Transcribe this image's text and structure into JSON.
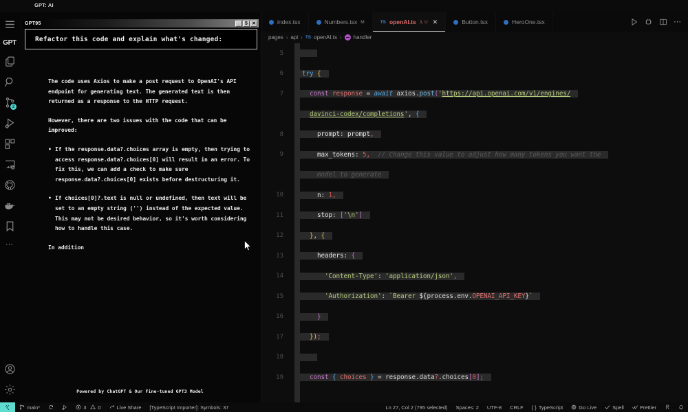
{
  "window": {
    "title": "GPT: AI"
  },
  "activity_bar": {
    "brand": "GPT",
    "items": [
      {
        "name": "menu-icon",
        "label": "Menu"
      },
      {
        "name": "explorer-icon",
        "label": "Explorer"
      },
      {
        "name": "search-icon",
        "label": "Search"
      },
      {
        "name": "source-control-icon",
        "label": "Source Control",
        "badge": "2"
      },
      {
        "name": "run-debug-icon",
        "label": "Run and Debug"
      },
      {
        "name": "extensions-icon",
        "label": "Extensions"
      },
      {
        "name": "remote-explorer-icon",
        "label": "Remote Explorer"
      },
      {
        "name": "github-icon",
        "label": "GitHub"
      },
      {
        "name": "docker-icon",
        "label": "Docker"
      },
      {
        "name": "bookmarks-icon",
        "label": "Bookmarks"
      },
      {
        "name": "more-views-icon",
        "label": "Additional Views"
      },
      {
        "name": "account-icon",
        "label": "Accounts"
      },
      {
        "name": "settings-gear-icon",
        "label": "Manage"
      }
    ]
  },
  "chat_panel": {
    "retro_window": {
      "title": "GPT95",
      "buttons": [
        {
          "name": "minimize-button",
          "glyph": "_"
        },
        {
          "name": "maximize-button",
          "glyph": "5"
        },
        {
          "name": "close-button",
          "glyph": "✕"
        }
      ]
    },
    "prompt": "Refactor this code and explain what's changed:",
    "paragraphs": [
      "The code uses Axios to make a post request to OpenAI's API endpoint for generating text. The generated text is then returned as a response to the HTTP request.",
      "However, there are two issues with the code that can be improved:"
    ],
    "bullets": [
      "If the response.data?.choices array is empty, then trying to access response.data?.choices[0] will result in an error. To fix this, we can add a check to make sure response.data?.choices[0] exists before destructuring it.",
      "If choices[0]?.text is null or undefined, then text will be set to an empty string ('') instead of the expected value. This may not be desired behavior, so it's worth considering how to handle this case."
    ],
    "tail": "In addition",
    "footer": "Powered by ChatGPT & Our Fine-tuned GPT3 Model"
  },
  "tabs": [
    {
      "name": "index.tsx",
      "suffix": "",
      "badge": "dot",
      "active": false
    },
    {
      "name": "Numbers.tsx",
      "suffix": "M",
      "badge": "dot",
      "active": false
    },
    {
      "name": "openAI.ts",
      "suffix": "3, U",
      "badge": "TS",
      "active": true,
      "close": "✕"
    },
    {
      "name": "Button.tsx",
      "suffix": "",
      "badge": "dot",
      "active": false
    },
    {
      "name": "HeroOne.tsx",
      "suffix": "",
      "badge": "dot",
      "active": false
    }
  ],
  "tab_actions": [
    {
      "name": "run-file-icon",
      "label": "Run Code"
    },
    {
      "name": "run-debug-split-icon",
      "label": "Run and Debug"
    },
    {
      "name": "split-editor-icon",
      "label": "Split Editor"
    },
    {
      "name": "more-actions-icon",
      "label": "More Actions..."
    }
  ],
  "breadcrumb": [
    "pages",
    "api",
    "openAI.ts",
    "handler"
  ],
  "code": {
    "lines": [
      {
        "n": "5",
        "segments": []
      },
      {
        "n": "6",
        "segments": [
          {
            "t": "  ",
            "c": "pun"
          },
          {
            "t": "try",
            "c": "kw2"
          },
          {
            "t": " ",
            "c": "pun"
          },
          {
            "t": "{",
            "c": "br1"
          }
        ]
      },
      {
        "n": "7",
        "segments": [
          {
            "t": "    ",
            "c": "pun"
          },
          {
            "t": "const",
            "c": "k"
          },
          {
            "t": " ",
            "c": "pun"
          },
          {
            "t": "response",
            "c": "var"
          },
          {
            "t": " = ",
            "c": "pun"
          },
          {
            "t": "await",
            "c": "aw"
          },
          {
            "t": " axios",
            "c": "id"
          },
          {
            "t": ".",
            "c": "pun"
          },
          {
            "t": "post",
            "c": "fn"
          },
          {
            "t": "(",
            "c": "br2"
          },
          {
            "t": "'",
            "c": "str"
          },
          {
            "t": "https://api.openai.com/v1/engines/",
            "c": "strU"
          }
        ]
      },
      {
        "n": "",
        "segments": [
          {
            "t": "    ",
            "c": "pun"
          },
          {
            "t": "davinci-codex/completions",
            "c": "strU"
          },
          {
            "t": "'",
            "c": "str"
          },
          {
            "t": ", ",
            "c": "pun"
          },
          {
            "t": "{",
            "c": "br3"
          }
        ]
      },
      {
        "n": "8",
        "segments": [
          {
            "t": "      ",
            "c": "pun"
          },
          {
            "t": "prompt",
            "c": "prop"
          },
          {
            "t": ": ",
            "c": "pun"
          },
          {
            "t": "prompt",
            "c": "prop"
          },
          {
            "t": ",",
            "c": "var"
          }
        ]
      },
      {
        "n": "9",
        "segments": [
          {
            "t": "      ",
            "c": "pun"
          },
          {
            "t": "max_tokens",
            "c": "prop"
          },
          {
            "t": ": ",
            "c": "pun"
          },
          {
            "t": "5",
            "c": "num"
          },
          {
            "t": ",",
            "c": "var"
          },
          {
            "t": "  // Change this value to adjust how many tokens you want the",
            "c": "cmt"
          }
        ]
      },
      {
        "n": "",
        "segments": [
          {
            "t": "      ",
            "c": "pun"
          },
          {
            "t": "model to generate",
            "c": "cmt"
          }
        ]
      },
      {
        "n": "10",
        "segments": [
          {
            "t": "      ",
            "c": "pun"
          },
          {
            "t": "n",
            "c": "prop"
          },
          {
            "t": ": ",
            "c": "pun"
          },
          {
            "t": "1",
            "c": "num"
          },
          {
            "t": ",",
            "c": "var"
          }
        ]
      },
      {
        "n": "11",
        "segments": [
          {
            "t": "      ",
            "c": "pun"
          },
          {
            "t": "stop",
            "c": "prop"
          },
          {
            "t": ": ",
            "c": "pun"
          },
          {
            "t": "[",
            "c": "br2"
          },
          {
            "t": "'\\n'",
            "c": "str"
          },
          {
            "t": "]",
            "c": "br2"
          }
        ]
      },
      {
        "n": "12",
        "segments": [
          {
            "t": "    ",
            "c": "pun"
          },
          {
            "t": "}",
            "c": "br1"
          },
          {
            "t": ", ",
            "c": "pun"
          },
          {
            "t": "{",
            "c": "br1"
          }
        ]
      },
      {
        "n": "13",
        "segments": [
          {
            "t": "      ",
            "c": "pun"
          },
          {
            "t": "headers",
            "c": "prop"
          },
          {
            "t": ": ",
            "c": "pun"
          },
          {
            "t": "{",
            "c": "br2"
          }
        ]
      },
      {
        "n": "14",
        "segments": [
          {
            "t": "        ",
            "c": "pun"
          },
          {
            "t": "'Content-Type'",
            "c": "str"
          },
          {
            "t": ": ",
            "c": "pun"
          },
          {
            "t": "'application/json'",
            "c": "str"
          },
          {
            "t": ",",
            "c": "var"
          }
        ]
      },
      {
        "n": "15",
        "segments": [
          {
            "t": "        ",
            "c": "pun"
          },
          {
            "t": "'Authorization'",
            "c": "str"
          },
          {
            "t": ": ",
            "c": "pun"
          },
          {
            "t": "`Bearer ",
            "c": "str"
          },
          {
            "t": "${",
            "c": "prop"
          },
          {
            "t": "process",
            "c": "id"
          },
          {
            "t": ".",
            "c": "pun"
          },
          {
            "t": "env",
            "c": "id"
          },
          {
            "t": ".",
            "c": "pun"
          },
          {
            "t": "OPENAI_API_KEY",
            "c": "env"
          },
          {
            "t": "}",
            "c": "prop"
          },
          {
            "t": "`",
            "c": "str"
          }
        ]
      },
      {
        "n": "16",
        "segments": [
          {
            "t": "      ",
            "c": "pun"
          },
          {
            "t": "}",
            "c": "br2"
          }
        ]
      },
      {
        "n": "17",
        "segments": [
          {
            "t": "    ",
            "c": "pun"
          },
          {
            "t": "}",
            "c": "br1"
          },
          {
            "t": ")",
            "c": "br1"
          },
          {
            "t": ";",
            "c": "var"
          }
        ]
      },
      {
        "n": "18",
        "segments": []
      },
      {
        "n": "19",
        "segments": [
          {
            "t": "    ",
            "c": "pun"
          },
          {
            "t": "const",
            "c": "k"
          },
          {
            "t": " ",
            "c": "pun"
          },
          {
            "t": "{ ",
            "c": "br3"
          },
          {
            "t": "choices",
            "c": "var"
          },
          {
            "t": " }",
            "c": "br3"
          },
          {
            "t": " = ",
            "c": "pun"
          },
          {
            "t": "response",
            "c": "id"
          },
          {
            "t": ".",
            "c": "pun"
          },
          {
            "t": "data",
            "c": "id"
          },
          {
            "t": "?",
            "c": "var"
          },
          {
            "t": ".",
            "c": "pun"
          },
          {
            "t": "choices",
            "c": "id"
          },
          {
            "t": "[",
            "c": "br2"
          },
          {
            "t": "0",
            "c": "num"
          },
          {
            "t": "]",
            "c": "br2"
          },
          {
            "t": ";",
            "c": "var"
          }
        ]
      }
    ]
  },
  "status_bar": {
    "left": [
      {
        "name": "remote-window-indicator",
        "label": ""
      },
      {
        "name": "branch-indicator",
        "label": "main*"
      },
      {
        "name": "sync-changes-button",
        "label": ""
      },
      {
        "name": "remote-debug-indicator",
        "label": ""
      },
      {
        "name": "problems-indicator",
        "label": "3",
        "warnings": "0"
      },
      {
        "name": "live-share-button",
        "label": "Live Share"
      },
      {
        "name": "typescript-importer-status",
        "label": "[TypeScript Importer]: Symbols: 37"
      }
    ],
    "right": [
      {
        "name": "cursor-position",
        "label": "Ln 27, Col 2 (795 selected)"
      },
      {
        "name": "indentation-setting",
        "label": "Spaces: 2"
      },
      {
        "name": "encoding-setting",
        "label": "UTF-8"
      },
      {
        "name": "eol-setting",
        "label": "CRLF"
      },
      {
        "name": "language-mode",
        "label": "TypeScript"
      },
      {
        "name": "go-live-button",
        "label": "Go Live"
      },
      {
        "name": "spell-checker-status",
        "label": "Spell"
      },
      {
        "name": "prettier-status",
        "label": "Prettier"
      },
      {
        "name": "feedback-icon",
        "label": ""
      },
      {
        "name": "notifications-bell-icon",
        "label": ""
      }
    ]
  },
  "colors": {
    "accent_teal": "#5fdcd0",
    "tab_active_red": "#e06c6c",
    "string_green": "#b5cc7a",
    "keyword_purple": "#c678c9",
    "background": "#0d0d0d"
  }
}
